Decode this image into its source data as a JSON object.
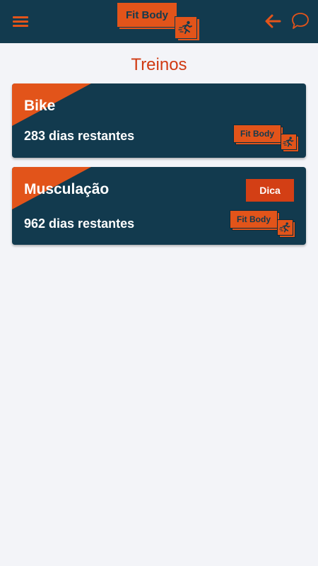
{
  "app": {
    "logo_text": "Fit Body"
  },
  "header": {
    "menu_icon": "hamburger-icon",
    "back_icon": "arrow-left-icon",
    "chat_icon": "chat-bubble-icon"
  },
  "page": {
    "title": "Treinos"
  },
  "cards": [
    {
      "title": "Bike",
      "days": "283 dias restantes",
      "badge_text": "Fit Body"
    },
    {
      "title": "Musculação",
      "days": "962 dias restantes",
      "badge_text": "Fit Body",
      "tip_label": "Dica"
    }
  ],
  "colors": {
    "primary": "#123a4e",
    "accent": "#e2541a",
    "title": "#d03a12",
    "background": "#f3f4f8"
  }
}
